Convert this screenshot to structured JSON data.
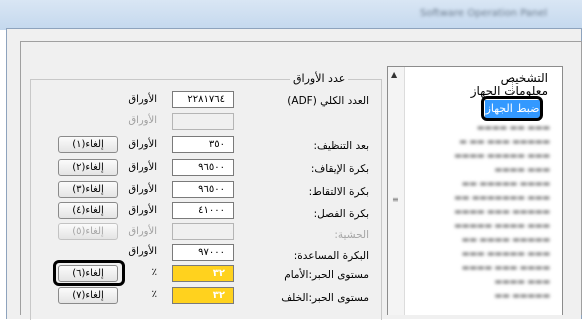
{
  "window": {
    "title": "Software Operation Panel"
  },
  "tree": {
    "items": [
      {
        "label": "التشخيص"
      },
      {
        "label": "معلومات الجهاز"
      },
      {
        "label": "ضبط الجهاز",
        "selected": true
      }
    ]
  },
  "group": {
    "title": "عدد الأوراق",
    "rows": [
      {
        "label": "العدد الكلي (ADF)",
        "value": "٢٢٨١٧٦٤",
        "unit": "الأوراق",
        "button": ""
      },
      {
        "label": "",
        "value": "",
        "unit": "الأوراق",
        "unit_disabled": true,
        "button": ""
      },
      {
        "label": "بعد التنظيف:",
        "value": "٣٥٠",
        "unit": "الأوراق",
        "button": "إلغاء(١)"
      },
      {
        "label": "بكرة الإيقاف:",
        "value": "٩٦٥٠٠",
        "unit": "الأوراق",
        "button": "إلغاء(٢)"
      },
      {
        "label": "بكرة الالتقاط:",
        "value": "٩٦٥٠٠",
        "unit": "الأوراق",
        "button": "إلغاء(٣)"
      },
      {
        "label": "بكرة الفصل:",
        "value": "٤١٠٠٠",
        "unit": "الأوراق",
        "button": "إلغاء(٤)"
      },
      {
        "label": "الحشية:",
        "label_disabled": true,
        "value": "",
        "value_disabled": true,
        "unit": "الأوراق",
        "unit_disabled": true,
        "button": "إلغاء(٥)",
        "button_disabled": true
      },
      {
        "label": "البكرة المساعدة:",
        "value": "٩٧٠٠٠",
        "unit": "الأوراق",
        "button": ""
      },
      {
        "label": "مستوى الحبر:الأمام",
        "value": "٣٢",
        "unit": "٪",
        "button": "إلغاء(٦)"
      },
      {
        "label": "مستوى الحبر:الخلف",
        "value": "٣٢",
        "unit": "٪",
        "button": "إلغاء(٧)"
      }
    ]
  },
  "colors": {
    "selection": "#3399ff",
    "ink_field": "#ffd21e"
  }
}
